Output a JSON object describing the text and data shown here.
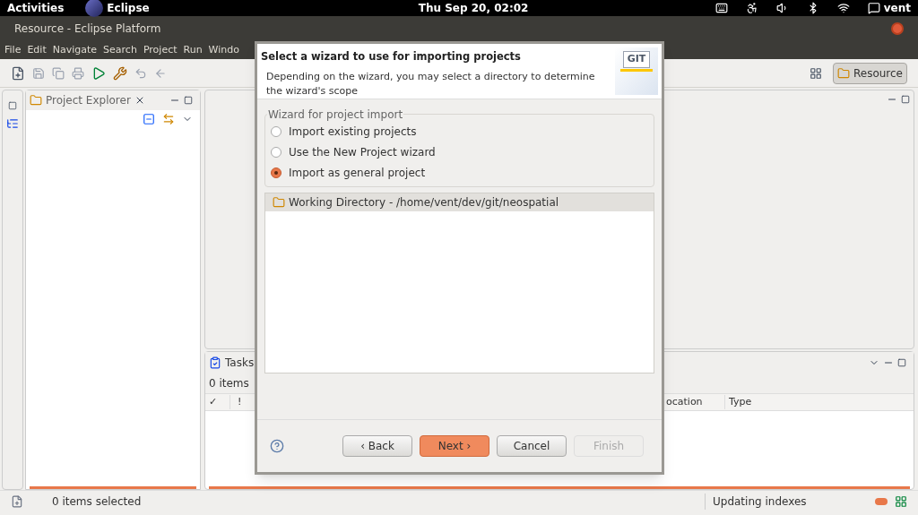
{
  "top_bar": {
    "activities": "Activities",
    "app": "Eclipse",
    "clock": "Thu Sep 20, 02:02",
    "user": "vent"
  },
  "window": {
    "title": "Resource - Eclipse Platform"
  },
  "menu": [
    "File",
    "Edit",
    "Navigate",
    "Search",
    "Project",
    "Run",
    "Windo"
  ],
  "perspective": {
    "label": "Resource",
    "selected": true
  },
  "project_explorer": {
    "title": "Project Explorer"
  },
  "tasks": {
    "title": "Tasks",
    "count": "0 items",
    "columns": [
      "✓",
      "!",
      "ocation",
      "Type"
    ]
  },
  "status_bar": {
    "selection": "0 items selected",
    "progress": "Updating indexes"
  },
  "dialog": {
    "title": "Select a wizard to use for importing projects",
    "description": "Depending on the wizard, you may select a directory to determine the wizard's scope",
    "badge": "GIT",
    "group": "Wizard for project import",
    "options": [
      {
        "label": "Import existing projects",
        "selected": false
      },
      {
        "label": "Use the New Project wizard",
        "selected": false
      },
      {
        "label": "Import as general project",
        "selected": true
      }
    ],
    "directory": "Working Directory - /home/vent/dev/git/neospatial",
    "buttons": [
      {
        "label": "‹ Back",
        "kind": "normal",
        "disabled": false
      },
      {
        "label": "Next ›",
        "kind": "default",
        "disabled": false
      },
      {
        "label": "Cancel",
        "kind": "normal",
        "disabled": false
      },
      {
        "label": "Finish",
        "kind": "normal",
        "disabled": true
      }
    ]
  }
}
